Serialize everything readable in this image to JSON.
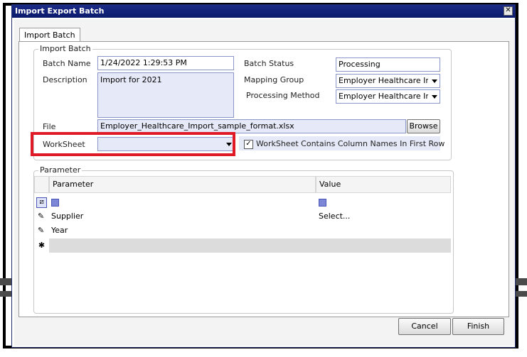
{
  "window": {
    "title": "Import Export Batch"
  },
  "tabs": [
    {
      "label": "Import Batch"
    }
  ],
  "import_batch": {
    "legend": "Import Batch",
    "batch_name_label": "Batch Name",
    "batch_name_value": "1/24/2022 1:29:53 PM",
    "description_label": "Description",
    "description_value": "Import for 2021",
    "batch_status_label": "Batch Status",
    "batch_status_value": "Processing",
    "mapping_group_label": "Mapping Group",
    "mapping_group_value": "Employer Healthcare Imp",
    "processing_method_label": "Processing Method",
    "processing_method_value": "Employer Healthcare Imp",
    "file_label": "File",
    "file_value": "Employer_Healthcare_Import_sample_format.xlsx",
    "browse_label": "Browse",
    "worksheet_label": "WorkSheet",
    "worksheet_value": "",
    "column_names_label": "WorkSheet Contains Column Names In First Row",
    "column_names_checked": "✓"
  },
  "parameter": {
    "legend": "Parameter",
    "columns": [
      "Parameter",
      "Value"
    ],
    "rows": [
      {
        "parameter": "Supplier",
        "value": "Select..."
      },
      {
        "parameter": "Year",
        "value": ""
      }
    ],
    "new_row_glyph": "✱"
  },
  "footer": {
    "cancel_label": "Cancel",
    "finish_label": "Finish"
  },
  "colors": {
    "title_bar": "#0a1a6c",
    "highlight": "#e01a26",
    "field_border": "#8a96c8"
  }
}
